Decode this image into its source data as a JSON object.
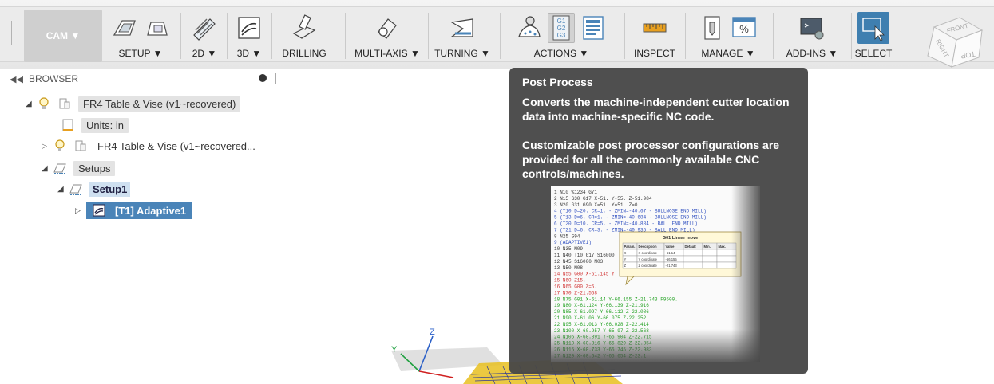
{
  "toolbar": {
    "workspace_label": "CAM ▼",
    "groups": [
      {
        "label": "SETUP ▼"
      },
      {
        "label": "2D ▼"
      },
      {
        "label": "3D ▼"
      },
      {
        "label": "DRILLING"
      },
      {
        "label": "MULTI-AXIS ▼"
      },
      {
        "label": "TURNING ▼"
      },
      {
        "label": "ACTIONS ▼"
      },
      {
        "label": "INSPECT"
      },
      {
        "label": "MANAGE ▼"
      },
      {
        "label": "ADD-INS ▼"
      },
      {
        "label": "SELECT"
      }
    ],
    "actions_gcode_lines": [
      "G1",
      "G2",
      "G3"
    ],
    "manage_percent": "%"
  },
  "viewcube": {
    "faces": [
      "FRONT",
      "RIGHT",
      "TOP"
    ]
  },
  "browser": {
    "title": "BROWSER",
    "collapse_glyph": "◀◀",
    "nodes": [
      {
        "label": "FR4 Table & Vise (v1~recovered)"
      },
      {
        "label": "Units: in"
      },
      {
        "label": "FR4 Table & Vise (v1~recovered..."
      },
      {
        "label": "Setups"
      },
      {
        "label": "Setup1"
      },
      {
        "label": "[T1] Adaptive1"
      }
    ]
  },
  "tooltip": {
    "title": "Post Process",
    "para1": "Converts the machine-independent cutter location data into machine-specific NC code.",
    "para2": "Customizable post processor configurations are provided for all the commonly available CNC controls/machines.",
    "nc_code": [
      {
        "text": "1 N10 %1234 G71",
        "color": "#333333"
      },
      {
        "text": "2 N15 G30 G17 X-51. Y-55. Z-51.984",
        "color": "#333333"
      },
      {
        "text": "3 N20 G31 G90 X=51. Y=51. Z=0.",
        "color": "#333333"
      },
      {
        "text": "4 (T10  D=20. CR=1. - ZMIN=-40.67 - BULLNOSE END MILL)",
        "color": "#3050c0"
      },
      {
        "text": "5 (T13  D=6. CR=1. - ZMIN=-40.684 - BULLNOSE END MILL)",
        "color": "#3050c0"
      },
      {
        "text": "6 (T20  D=10. CR=5. - ZMIN=-40.884 - BALL END MILL)",
        "color": "#3050c0"
      },
      {
        "text": "7 (T21  D=6. CR=3. - ZMIN=-40.935 - BALL END MILL)",
        "color": "#3050c0"
      },
      {
        "text": "8 N25 G94",
        "color": "#333333"
      },
      {
        "text": "9 (ADAPTIVE1)",
        "color": "#3050c0"
      },
      {
        "text": "10 N35 M09",
        "color": "#333333"
      },
      {
        "text": "11 N40 T10 G17 S16000",
        "color": "#333333"
      },
      {
        "text": "12 N45 S16000 M03",
        "color": "#333333"
      },
      {
        "text": "13 N50 M08",
        "color": "#333333"
      },
      {
        "text": "14 N55 G00 X-61.145 Y",
        "color": "#d03030"
      },
      {
        "text": "15 N60 Z15.",
        "color": "#d03030"
      },
      {
        "text": "16 N65 G00 Z=5.",
        "color": "#d03030"
      },
      {
        "text": "17 N70 Z-21.568",
        "color": "#d03030"
      },
      {
        "text": "18 N75 G01 X-61.14 Y-66.155 Z-21.743 F9500.",
        "color": "#20a020"
      },
      {
        "text": "19 N80 X-61.124 Y-66.139 Z-21.916",
        "color": "#20a020"
      },
      {
        "text": "20 N85 X-61.097 Y-66.112 Z-22.086",
        "color": "#20a020"
      },
      {
        "text": "21 N90 X-61.06 Y-66.075 Z-22.252",
        "color": "#20a020"
      },
      {
        "text": "22 N95 X-61.013 Y-66.028 Z-22.414",
        "color": "#20a020"
      },
      {
        "text": "23 N100 X-60.957 Y-65.97 Z-22.568",
        "color": "#20a020"
      },
      {
        "text": "24 N105 X-60.891 Y-65.904 Z-22.715",
        "color": "#20a020"
      },
      {
        "text": "25 N110 X-60.816 Y-65.829 Z-22.854",
        "color": "#20a020"
      },
      {
        "text": "26 N115 X-60.733 Y-65.745 Z-22.983",
        "color": "#20a020"
      },
      {
        "text": "27 N120 X-60.642 Y-65.654 Z-23.1",
        "color": "#20a020"
      }
    ],
    "g01_table": {
      "title": "G01 Linear move",
      "headers": [
        "Param.",
        "Description",
        "Value",
        "Default",
        "Min.",
        "Max."
      ],
      "rows": [
        [
          "X",
          "X coordinate",
          "-61.14",
          "",
          "",
          ""
        ],
        [
          "Y",
          "Y coordinate",
          "-66.155",
          "",
          "",
          ""
        ],
        [
          "Z",
          "Z coordinate",
          "-21.743",
          "",
          "",
          ""
        ]
      ]
    }
  },
  "viewport": {
    "axis_labels": {
      "z": "Z",
      "y": "Y"
    }
  },
  "colors": {
    "tooltip_bg": "#484848",
    "selection_blue": "#4a84b8",
    "accent_orange": "#e8a020"
  }
}
